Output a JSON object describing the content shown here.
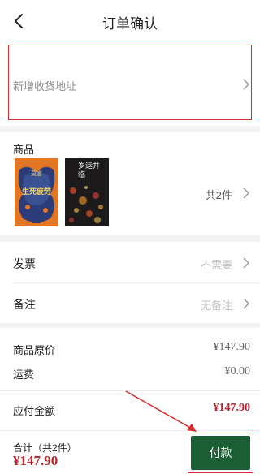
{
  "header": {
    "title": "订单确认",
    "back_icon": "chevron-left-icon"
  },
  "address": {
    "placeholder": "新增收货地址",
    "highlight_color": "#d62b2b"
  },
  "goods": {
    "title": "商品",
    "count_label": "共2件",
    "books": [
      {
        "cover_text": "生死疲劳",
        "cover_author": "莫言",
        "cover_color": "#e37622"
      },
      {
        "cover_text": "岁运并临",
        "cover_color": "#1d1a1b"
      }
    ]
  },
  "invoice": {
    "label": "发票",
    "value": "不需要"
  },
  "remark": {
    "label": "备注",
    "value": "无备注"
  },
  "prices": {
    "original_label": "商品原价",
    "original_value": "¥147.90",
    "shipping_label": "运费",
    "shipping_value": "¥0.00",
    "due_label": "应付金额",
    "due_value": "¥147.90"
  },
  "footer": {
    "total_label": "合计（共2件）",
    "total_amount": "¥147.90",
    "pay_label": "付款",
    "pay_color": "#1c5e33"
  }
}
